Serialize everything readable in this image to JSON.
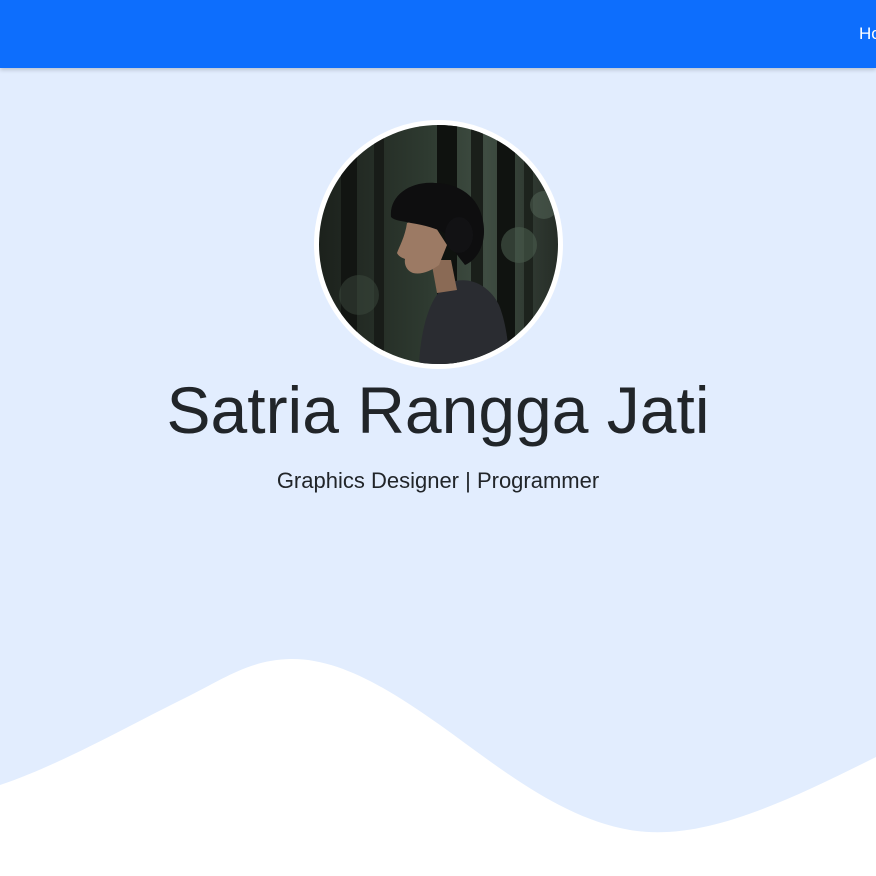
{
  "navbar": {
    "links": [
      {
        "label": "Home"
      }
    ]
  },
  "hero": {
    "name": "Satria Rangga Jati",
    "tagline": "Graphics Designer | Programmer"
  },
  "colors": {
    "navbar": "#0d6efd",
    "hero_background": "#e2edfe",
    "text": "#212529",
    "wave": "#ffffff"
  }
}
